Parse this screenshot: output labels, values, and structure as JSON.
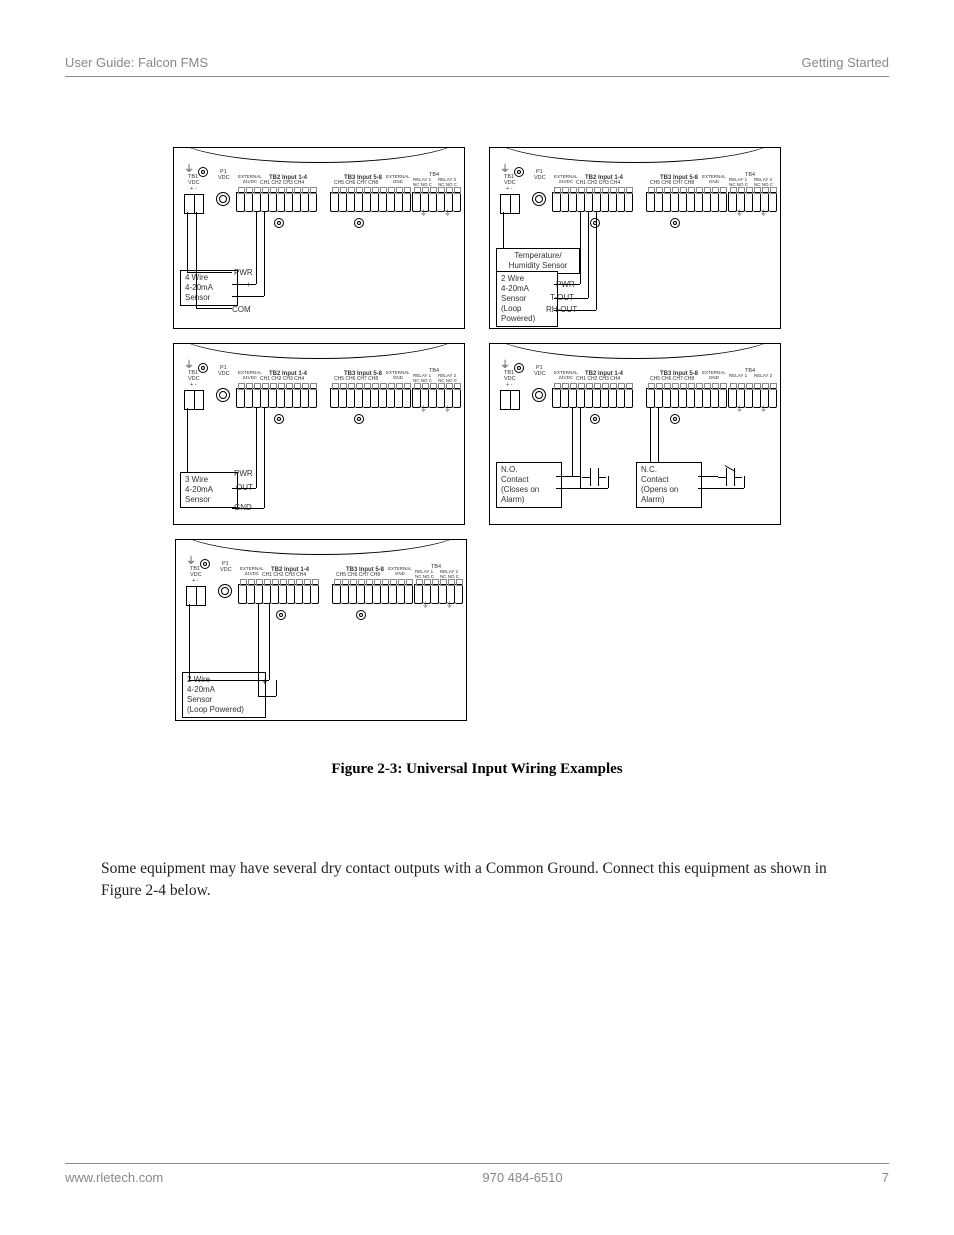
{
  "header": {
    "left": "User Guide: Falcon FMS",
    "right": "Getting Started"
  },
  "panels": {
    "common_labels": {
      "tb1": "TB1",
      "vdc": "VDC",
      "pm": "+ -",
      "p1": "P1",
      "p1vdc": "VDC",
      "p1ext": "EXTERNAL\n24VDC",
      "tb2": "TB2 Input 1-4",
      "tb2ch": "CH1  CH2  CH3  CH4",
      "tb3": "TB3 Input 5-8",
      "tb3ch": "CH5  CH6  CH7  CH8",
      "extgnd": "EXTERNAL\nGND",
      "tb4": "TB4",
      "relay1": "RELAY 1",
      "relay2": "RELAY 2",
      "nonc": "NC NO C",
      "ground_sym": "⏚"
    },
    "a": {
      "box_lines": [
        "4 Wire",
        "4-20mA",
        "Sensor"
      ],
      "pins": [
        "PWR",
        "+",
        "-",
        "COM"
      ]
    },
    "b": {
      "sup_box": [
        "Temperature/",
        "Humidity Sensor"
      ],
      "box_lines": [
        "2 Wire",
        "4-20mA",
        "Sensor",
        "(Loop",
        "Powered)"
      ],
      "pins": [
        "PWR",
        "T-OUT",
        "RH-OUT"
      ]
    },
    "c": {
      "box_lines": [
        "3 Wire",
        "4-20mA",
        "Sensor"
      ],
      "pins": [
        "PWR",
        "OUT",
        "GND"
      ]
    },
    "d": {
      "box1": [
        "N.O.",
        "Contact",
        "(Closes on",
        "Alarm)"
      ],
      "box2": [
        "N.C.",
        "Contact",
        "(Opens on",
        "Alarm)"
      ]
    },
    "e": {
      "box_lines": [
        "2 Wire",
        "4-20mA",
        "Sensor",
        "(Loop Powered)"
      ],
      "pins": [
        "+",
        "-"
      ]
    }
  },
  "caption": "Figure 2-3: Universal Input Wiring Examples",
  "body": "Some equipment may have several dry contact outputs with a Common Ground. Connect this equipment as shown in Figure 2-4 below.",
  "footer": {
    "left": "www.rletech.com",
    "center": "970 484-6510",
    "right": "7"
  }
}
